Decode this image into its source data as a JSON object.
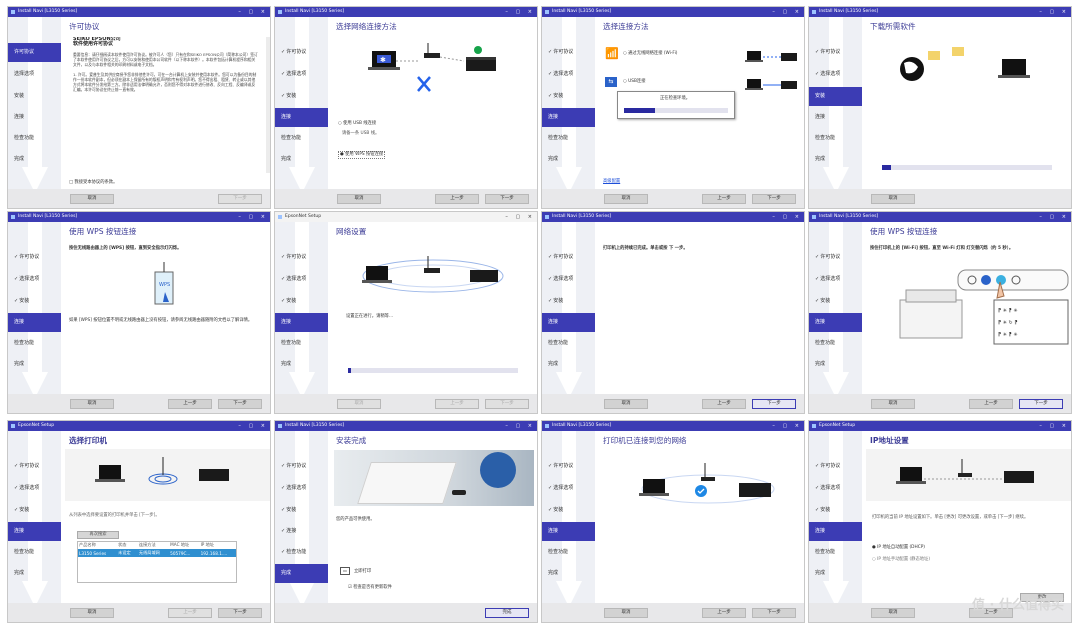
{
  "watermark": "值 · 什么值得买",
  "footer_buttons": {
    "cancel": "取消",
    "prev": "上一步",
    "next": "下一步",
    "finish": "完成",
    "refresh": "更改"
  },
  "steps_a": [
    "许可协议",
    "选择选项",
    "安装",
    "连接",
    "检查功能",
    "完成"
  ],
  "steps_b": [
    "许可协议",
    "选择选项",
    "安装",
    "连接",
    "检查功能",
    "完成"
  ],
  "panels": [
    {
      "window_title": "Install Navi [L3150 Series]",
      "title": "许可协议",
      "active_step": 0,
      "company": "SEIKO EPSON公司",
      "doc_title": "软件使用许可协议",
      "para1": "重要信息：请仔细阅读本软件使用许可协议。被许可人（您）只有在和SEIKO EPSON公司（简称本公司）签订了本软件使用许可协议之后，方可以安装和使用本公司软件（以下称本软件）。本软件包括计算机程序和相关文件，以及与本软件相关的印刷材料或电子文档。",
      "para2": "1. 许可。爱普生及其供应商授予您非排他性许可，可在一台计算机上安装并使用本软件。您可以为备份目的制作一份本软件副本，但必须在副本上保留所有的版权声明和专有权利声明。您不得出租、租赁、转让或以其他方式将本软件分发给第三方。除非适用法律明确允许，否则您不得对本软件进行修改、反向工程、反编译或反汇编。本许可协议在终止前一直有效。",
      "agree": "□ 我接受本协议的条款。"
    },
    {
      "window_title": "Install Navi [L3150 Series]",
      "title": "选择网络连接方法",
      "active_step": 3,
      "opt1": "○ 使用 USB 线连接",
      "opt1_sub": "请备一条 USB 线。",
      "opt2": "● 使用 WPS 按钮连接"
    },
    {
      "window_title": "Install Navi [L3150 Series]",
      "title": "选择连接方法",
      "active_step": 3,
      "opt1": "○ 通过无线网络连接 (Wi-Fi)",
      "opt2": "○ USB连接",
      "dialog_text": "正在检查环境。",
      "link": "高级配置"
    },
    {
      "window_title": "Install Navi [L3150 Series]",
      "title": "下载所需软件",
      "active_step": 2,
      "progress": 0.05
    },
    {
      "window_title": "Install Navi [L3150 Series]",
      "title": "使用 WPS 按钮连接",
      "active_step": 3,
      "text1": "按住无线路由器上的 [WPS] 按钮，直到安全指示灯闪烁。",
      "text2": "如果 [WPS] 按钮位置不明或无线路由器上没有按钮，请参阅无线路由器随附的文档以了解详情。"
    },
    {
      "window_title": "EpsonNet Setup",
      "title": "网络设置",
      "active_step": 3,
      "text1": "设置正在进行。请稍等...",
      "progress": 0.02
    },
    {
      "window_title": "Install Navi [L3150 Series]",
      "title": "",
      "active_step": 3,
      "text1": "打印机上的持续已完成。单击或按 下 一步。"
    },
    {
      "window_title": "Install Navi [L3150 Series]",
      "title": "使用 WPS 按钮连接",
      "active_step": 3,
      "text1": "按住打印机上的 [Wi-Fi] 按钮，直至 Wi-Fi 灯和 灯交替闪烁（约 5 秒）。"
    },
    {
      "window_title": "EpsonNet Setup",
      "title": "选择打印机",
      "active_step": 3,
      "text1": "从列表中选择要设置的打印机并单击 [下一步]。",
      "search_btn": "再次搜索",
      "cols": [
        "产品名称",
        "状态",
        "连接方法",
        "MAC 地址",
        "IP 地址"
      ],
      "row": [
        "L3150 Series",
        "未设定",
        "无线局域网",
        "50579C...",
        "192.168.1...."
      ]
    },
    {
      "window_title": "Install Navi [L3150 Series]",
      "title": "安装完成",
      "active_step": 5,
      "text1": "您的产品可供使用。",
      "item1": "立即打印",
      "check1": "☑ 检查是否有更新软件"
    },
    {
      "window_title": "Install Navi [L3150 Series]",
      "title": "打印机已连接到您的网络",
      "active_step": 3
    },
    {
      "window_title": "EpsonNet Setup",
      "title": "IP地址设置",
      "active_step": 3,
      "text1": "打印机的当前 IP 地址设置如下。单击 [更改] 可更改设置，或单击 [下一步] 继续。",
      "opt1": "● IP 地址自动配置 (DHCP)",
      "opt2": "○ IP 地址手动配置 (静态地址)"
    }
  ]
}
